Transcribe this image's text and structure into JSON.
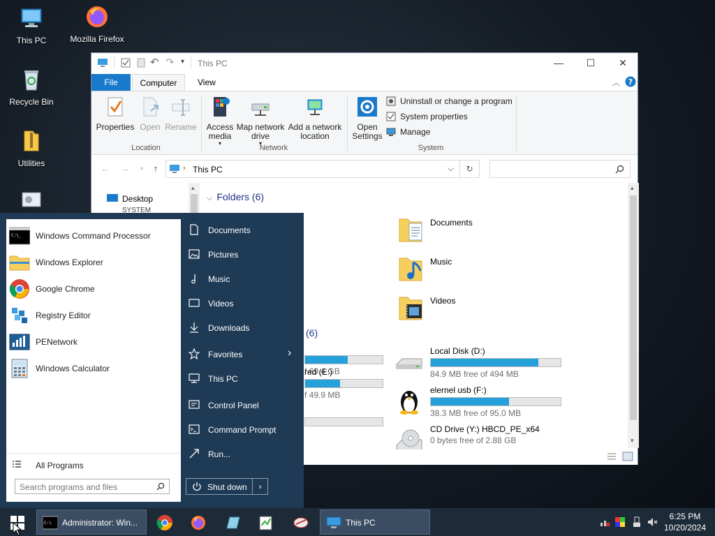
{
  "desktop": {
    "icons": [
      {
        "label": "This PC"
      },
      {
        "label": "Mozilla Firefox"
      },
      {
        "label": "Recycle Bin"
      },
      {
        "label": "Utilities"
      }
    ]
  },
  "explorer": {
    "title": "This PC",
    "tabs": {
      "file": "File",
      "computer": "Computer",
      "view": "View"
    },
    "ribbon": {
      "location": {
        "label": "Location",
        "properties": "Properties",
        "open": "Open",
        "rename": "Rename"
      },
      "network": {
        "label": "Network",
        "access_media": "Access media",
        "map_drive": "Map network drive",
        "add_location": "Add a network location"
      },
      "system": {
        "label": "System",
        "open_settings": "Open Settings",
        "uninstall": "Uninstall or change a program",
        "system_properties": "System properties",
        "manage": "Manage"
      }
    },
    "address": {
      "path": "This PC"
    },
    "nav": {
      "desktop": "Desktop",
      "system": "SYSTEM"
    },
    "folders": {
      "header": "Folders (6)",
      "items": [
        {
          "name": "Documents"
        },
        {
          "name": "Music"
        },
        {
          "name": "Videos"
        }
      ]
    },
    "drives": {
      "header_count": "(6)",
      "left_partial": [
        {
          "free": "f 69.4 GB",
          "fill": 0.55
        },
        {
          "name": "red (E:)",
          "free": "f 49.9 MB",
          "fill": 0.45
        },
        {
          "free": "",
          "fill": 0.0
        }
      ],
      "items": [
        {
          "name": "Local Disk (D:)",
          "free": "84.9 MB free of 494 MB",
          "fill": 0.83
        },
        {
          "name": "elernel usb (F:)",
          "free": "38.3 MB free of 95.0 MB",
          "fill": 0.6
        },
        {
          "name": "CD Drive (Y:) HBCD_PE_x64",
          "free": "0 bytes free of 2.88 GB",
          "fill": 1.0
        }
      ]
    }
  },
  "start_menu": {
    "programs": [
      {
        "label": "Windows Command Processor"
      },
      {
        "label": "Windows Explorer"
      },
      {
        "label": "Google Chrome"
      },
      {
        "label": "Registry Editor"
      },
      {
        "label": "PENetwork"
      },
      {
        "label": "Windows Calculator"
      }
    ],
    "all_programs": "All Programs",
    "search_placeholder": "Search programs and files",
    "right_items": [
      {
        "label": "Documents"
      },
      {
        "label": "Pictures"
      },
      {
        "label": "Music"
      },
      {
        "label": "Videos"
      },
      {
        "label": "Downloads"
      },
      {
        "label": "Favorites"
      },
      {
        "label": "This PC"
      },
      {
        "label": "Control Panel"
      },
      {
        "label": "Command Prompt"
      },
      {
        "label": "Run..."
      }
    ],
    "shutdown": "Shut down"
  },
  "taskbar": {
    "tasks": [
      {
        "label": "Administrator: Win..."
      },
      {
        "label": "This PC"
      }
    ],
    "clock": {
      "time": "6:25 PM",
      "date": "10/20/2024"
    }
  },
  "colors": {
    "accent": "#1979ca",
    "progress": "#26a0da",
    "start_bg": "#1f3a55",
    "taskbar": "#1d2a38"
  }
}
